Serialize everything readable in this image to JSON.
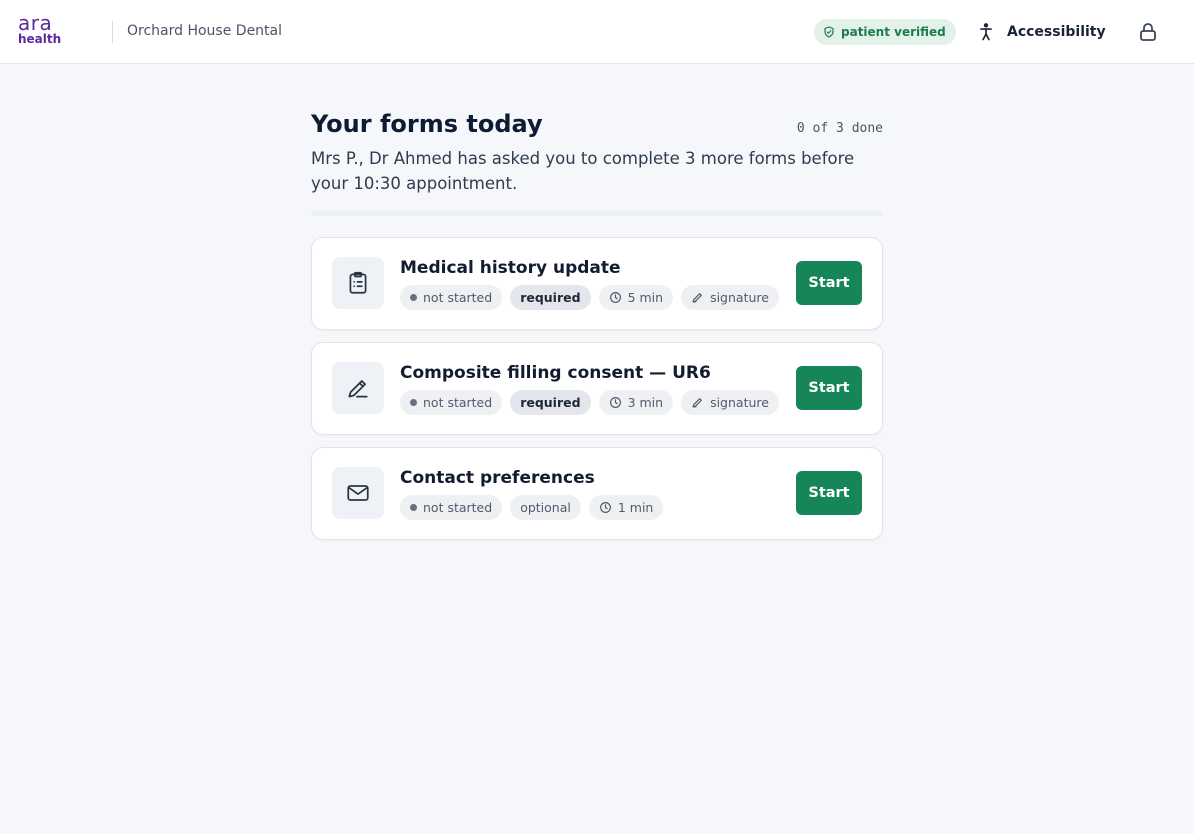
{
  "header": {
    "logo_line1": "ara",
    "logo_line2": "health",
    "clinic_name": "Orchard House Dental",
    "verified_label": "patient verified",
    "accessibility_label": "Accessibility"
  },
  "main": {
    "title": "Your forms today",
    "progress_text": "0 of 3 done",
    "progress_fraction": 0,
    "subtitle": "Mrs P., Dr Ahmed has asked you to complete 3 more forms before your 10:30 appointment."
  },
  "forms": [
    {
      "icon": "clipboard-list-icon",
      "title": "Medical history update",
      "status": "not started",
      "requirement": "required",
      "duration": "5 min",
      "signature": "signature",
      "button": "Start"
    },
    {
      "icon": "pencil-sign-icon",
      "title": "Composite filling consent — UR6",
      "status": "not started",
      "requirement": "required",
      "duration": "3 min",
      "signature": "signature",
      "button": "Start"
    },
    {
      "icon": "envelope-icon",
      "title": "Contact preferences",
      "status": "not started",
      "requirement": "optional",
      "duration": "1 min",
      "button": "Start"
    }
  ],
  "colors": {
    "brand": "#5b2a9e",
    "primary_button": "#168558",
    "verified_text": "#1f7a4f",
    "verified_bg": "#e2f2ea",
    "page_bg": "#f5f7fa"
  }
}
